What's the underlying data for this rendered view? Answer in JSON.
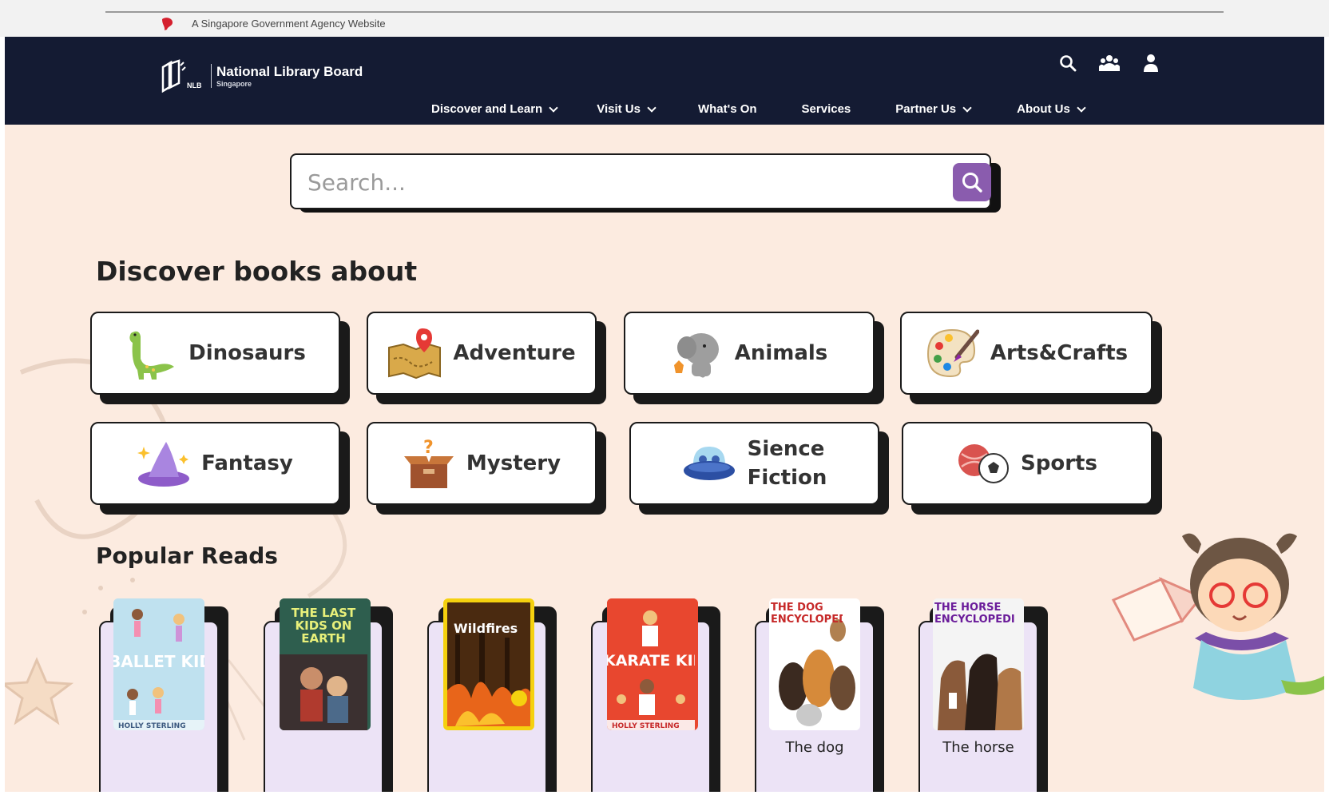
{
  "gov_banner": {
    "text": "A Singapore Government Agency Website"
  },
  "header": {
    "logo_title": "National Library Board",
    "logo_subtitle": "Singapore",
    "logo_mark_text": "NLB",
    "icons": [
      "search-icon",
      "community-icon",
      "user-icon"
    ],
    "menu": [
      {
        "label": "Discover and Learn",
        "has_dropdown": true
      },
      {
        "label": "Visit Us",
        "has_dropdown": true
      },
      {
        "label": "What's On",
        "has_dropdown": false
      },
      {
        "label": "Services",
        "has_dropdown": false
      },
      {
        "label": "Partner Us",
        "has_dropdown": true
      },
      {
        "label": "About Us",
        "has_dropdown": true
      }
    ]
  },
  "search": {
    "placeholder": "Search...",
    "value": ""
  },
  "discover": {
    "heading": "Discover books about",
    "categories": [
      {
        "label": "Dinosaurs",
        "icon": "dinosaur-icon"
      },
      {
        "label": "Adventure",
        "icon": "treasure-map-icon"
      },
      {
        "label": "Animals",
        "icon": "elephant-icon"
      },
      {
        "label": "Arts&Crafts",
        "icon": "paint-palette-icon"
      },
      {
        "label": "Fantasy",
        "icon": "wizard-hat-icon"
      },
      {
        "label": "Mystery",
        "icon": "mystery-box-icon"
      },
      {
        "label": "Sience Fiction",
        "label_line1": "Sience",
        "label_line2": "Fiction",
        "icon": "ufo-icon"
      },
      {
        "label": "Sports",
        "icon": "sports-balls-icon"
      }
    ]
  },
  "popular": {
    "heading": "Popular Reads",
    "books": [
      {
        "cover_text": "BALLET KID",
        "cover_author": "HOLLY STERLING",
        "title": ""
      },
      {
        "cover_text": "THE LAST KIDS ON EARTH",
        "cover_author": "",
        "title": ""
      },
      {
        "cover_text": "Wildfires",
        "cover_author": "",
        "title": ""
      },
      {
        "cover_text": "KARATE KID",
        "cover_author": "HOLLY STERLING",
        "title": ""
      },
      {
        "cover_text": "THE DOG ENCYCLOPEDIA",
        "cover_author": "",
        "title": "The dog"
      },
      {
        "cover_text": "THE HORSE ENCYCLOPEDIA",
        "cover_author": "",
        "title": "The horse"
      }
    ]
  },
  "colors": {
    "navbar": "#141b33",
    "page_background": "#fcebe0",
    "search_button": "#8a5cae",
    "book_card": "#ece3f6"
  }
}
